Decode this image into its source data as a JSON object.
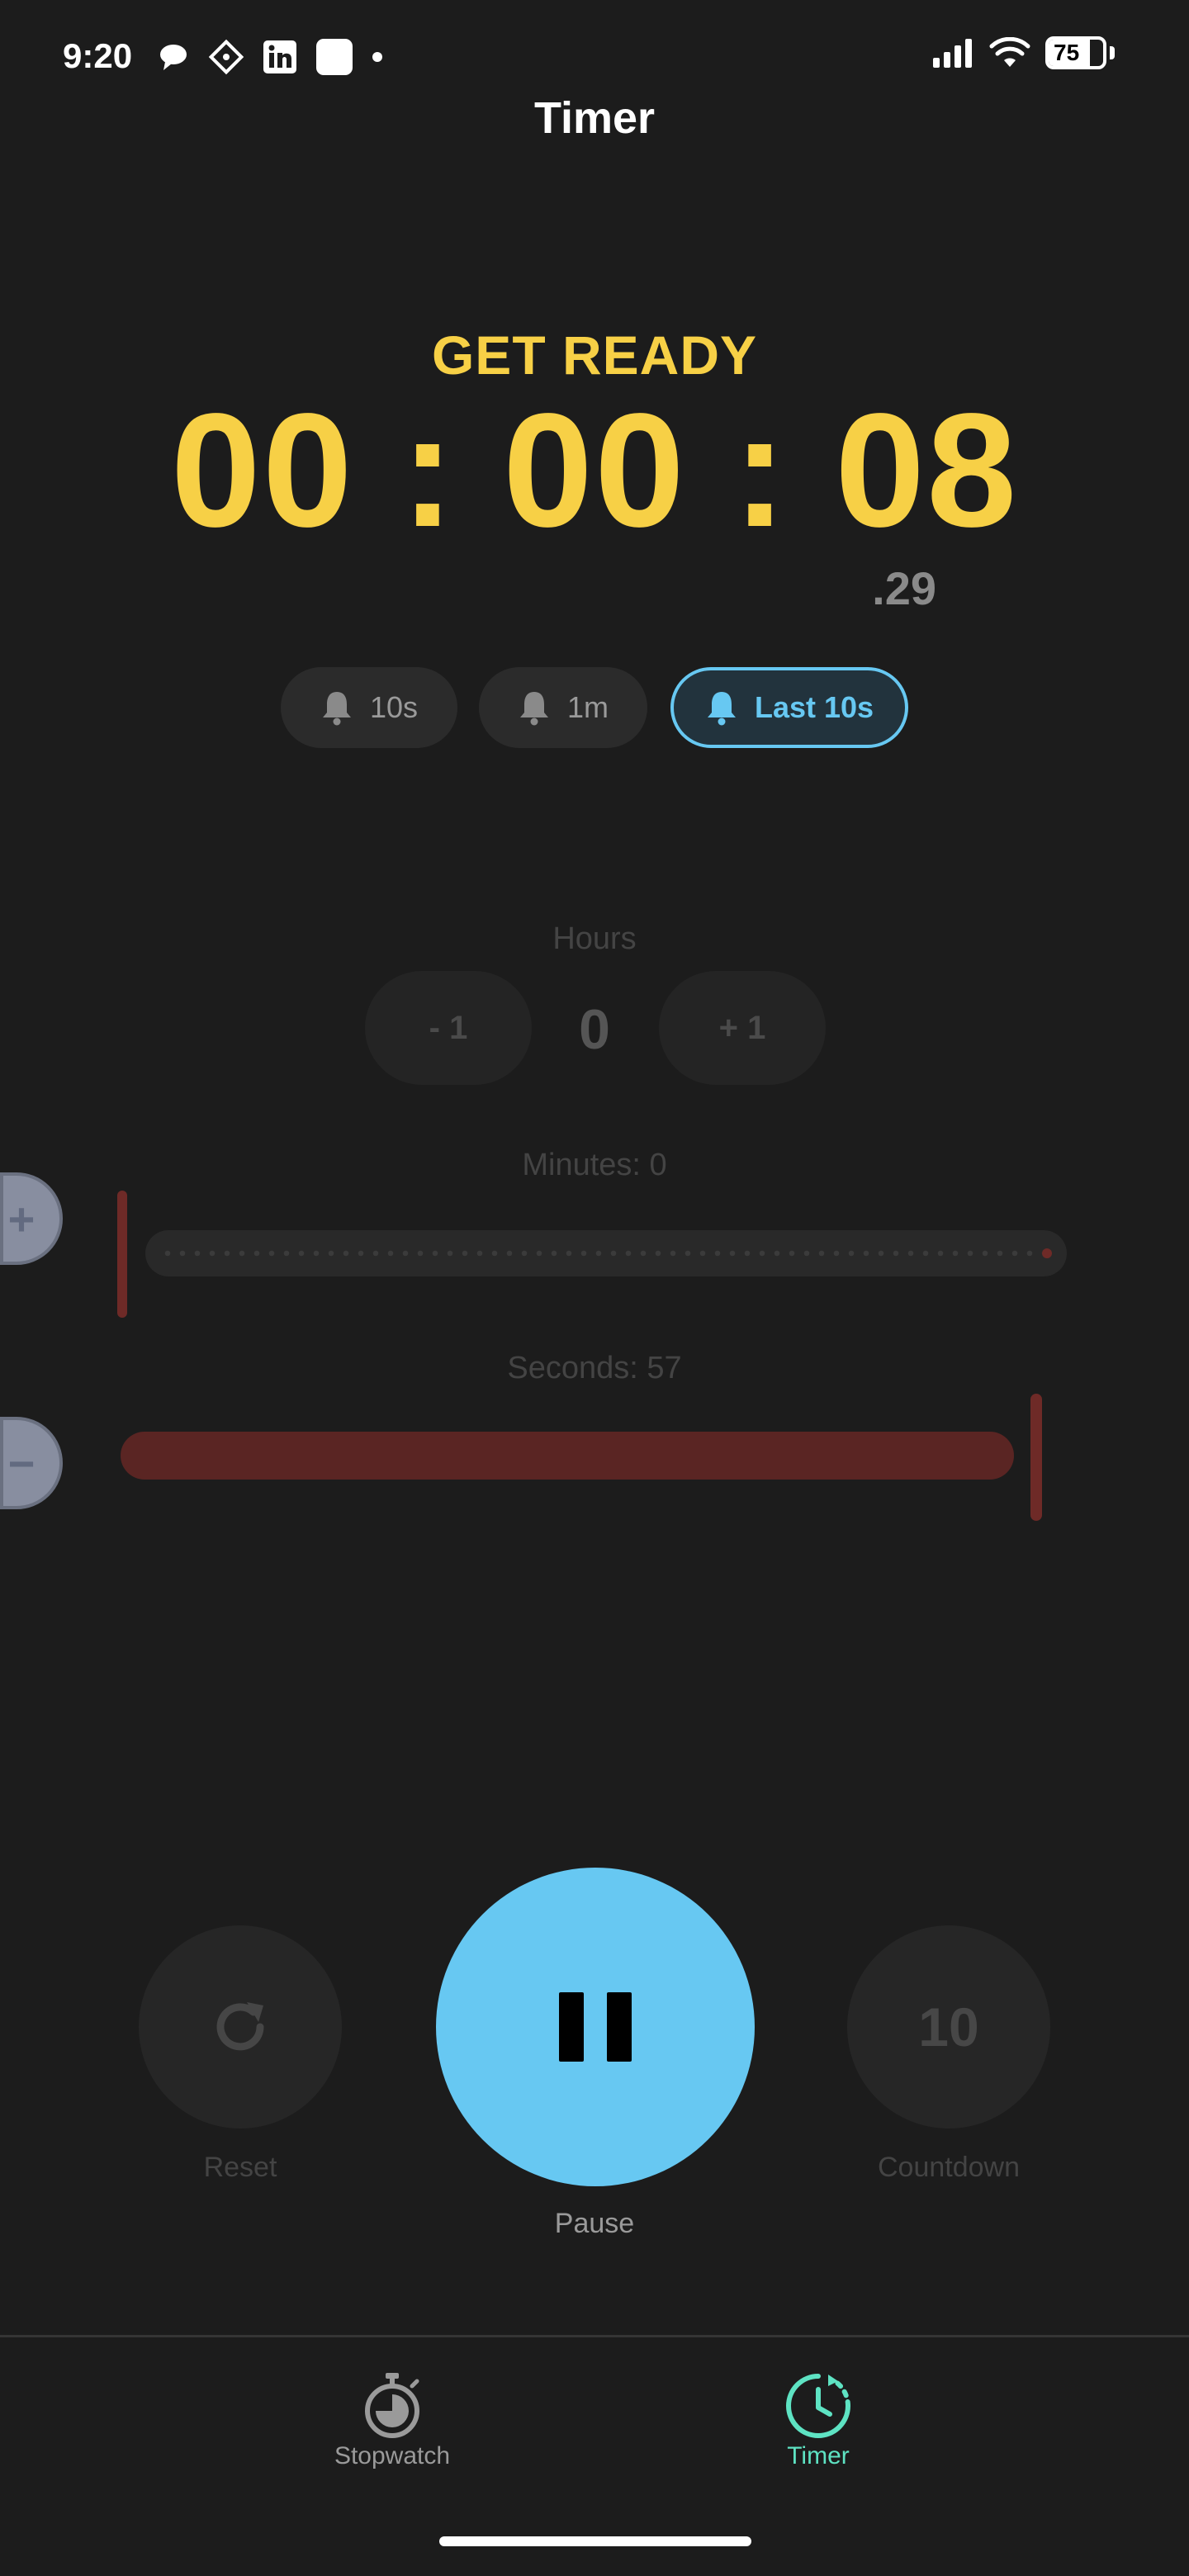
{
  "status_bar": {
    "time": "9:20",
    "battery": "75",
    "left_icons": [
      "chat-bubble-icon",
      "diamond-icon",
      "linkedin-icon",
      "app-square-icon",
      "dot-icon"
    ],
    "right_icons": [
      "signal-icon",
      "wifi-icon",
      "battery-icon"
    ]
  },
  "header": {
    "title": "Timer"
  },
  "timer": {
    "state": "GET READY",
    "display": "00 : 00 : 08",
    "hundredths": ".29",
    "color": "#f7d046"
  },
  "alert_chips": [
    {
      "label": "10s",
      "icon": "bell-icon",
      "active": false
    },
    {
      "label": "1m",
      "icon": "bell-icon",
      "active": false
    },
    {
      "label": "Last 10s",
      "icon": "bell-icon",
      "active": true
    }
  ],
  "hours": {
    "label": "Hours",
    "minus_label": "- 1",
    "value": "0",
    "plus_label": "+ 1"
  },
  "minutes": {
    "label": "Minutes: 0",
    "value": 0,
    "max": 59
  },
  "seconds": {
    "label": "Seconds: 57",
    "value": 57,
    "max": 59
  },
  "side_controls": {
    "plus_glyph": "+",
    "minus_glyph": "−"
  },
  "controls": {
    "reset_label": "Reset",
    "pause_label": "Pause",
    "countdown_label": "Countdown",
    "countdown_value": "10",
    "accent": "#67c8f2"
  },
  "bottom_nav": [
    {
      "label": "Stopwatch",
      "icon": "stopwatch-icon",
      "active": false
    },
    {
      "label": "Timer",
      "icon": "timer-icon",
      "active": true
    }
  ],
  "colors": {
    "background": "#1c1c1c",
    "accent_teal": "#5ee3c3",
    "accent_blue": "#67c8f2",
    "slider_red": "#6e2a27"
  }
}
